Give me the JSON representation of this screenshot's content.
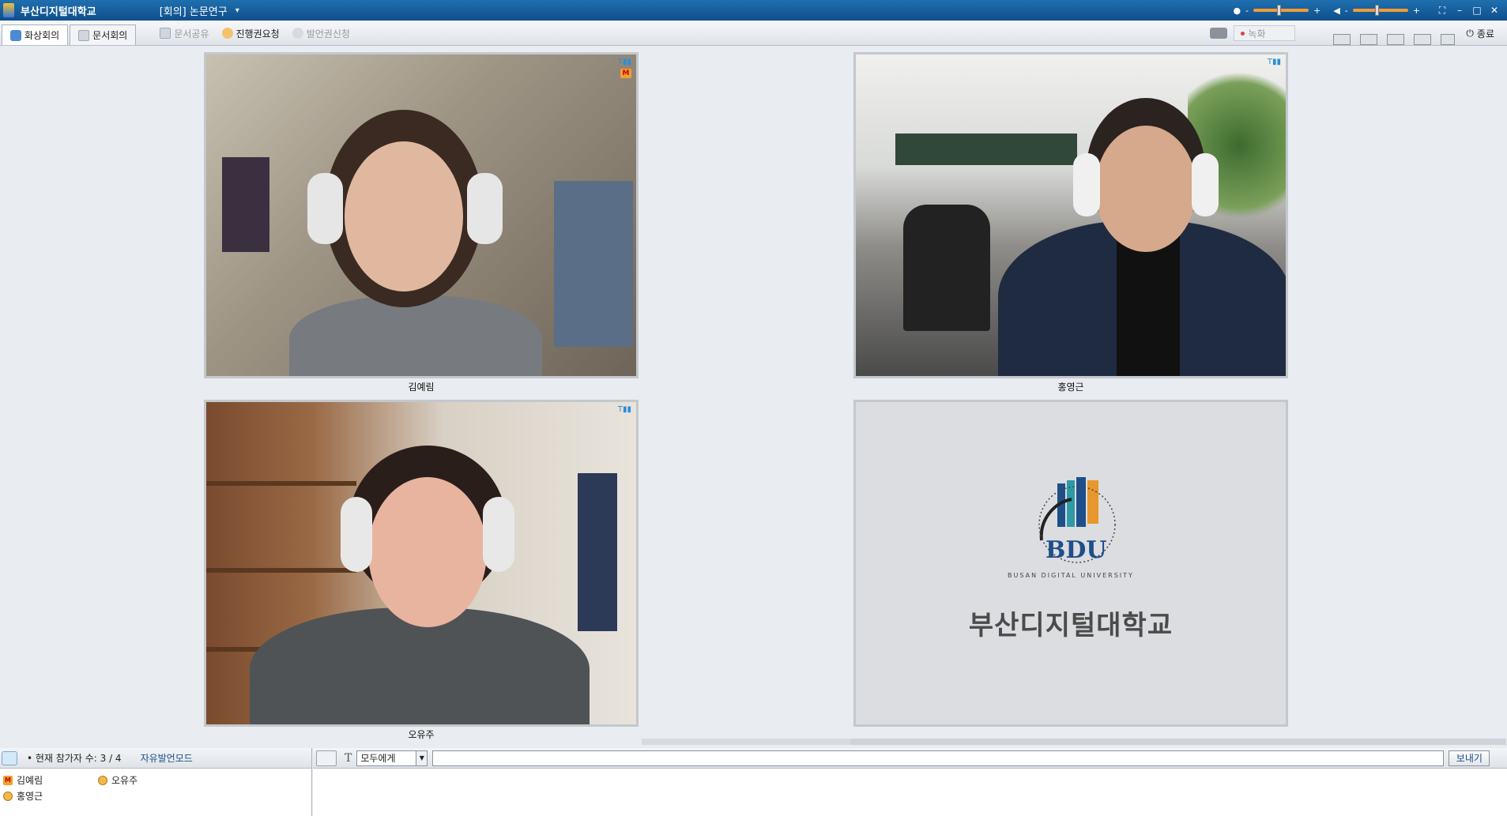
{
  "titlebar": {
    "app_title": "부산디지털대학교",
    "meeting_title": "[회의] 논문연구",
    "caret": "▾",
    "volume_icon": "speaker-icon",
    "mic_icon": "microphone-icon"
  },
  "toolbar": {
    "tabs": [
      {
        "label": "화상회의",
        "icon": "camera-icon"
      },
      {
        "label": "문서회의",
        "icon": "document-icon"
      }
    ],
    "tools": [
      {
        "label": "문서공유",
        "enabled": false,
        "icon": "document-share-icon"
      },
      {
        "label": "진행권요청",
        "enabled": true,
        "icon": "hand-icon"
      },
      {
        "label": "발언권신청",
        "enabled": false,
        "icon": "raise-hand-icon"
      }
    ],
    "record_label": "녹화",
    "exit_label": "종료"
  },
  "videos": [
    {
      "name": "김예림",
      "host": true,
      "host_badge": "M"
    },
    {
      "name": "홍영근",
      "host": false
    },
    {
      "name": "오유주",
      "host": false
    }
  ],
  "logo_tile": {
    "logo_text": "BDU",
    "ring_text": "BUSAN DIGITAL UNIVERSITY",
    "school_name": "부산디지털대학교",
    "colors": {
      "blue": "#1e4f8a",
      "orange": "#e8962e",
      "teal": "#2e9aa8"
    }
  },
  "participants_panel": {
    "count_label": "• 현재 참가자 수: 3 / 4",
    "mode_label": "자유발언모드",
    "list": [
      {
        "name": "김예림",
        "role": "host",
        "badge": "M"
      },
      {
        "name": "오유주",
        "role": "user"
      },
      {
        "name": "홍영근",
        "role": "user"
      }
    ]
  },
  "chat": {
    "font_icon": "T",
    "target_select": "모두에게",
    "input_value": "",
    "send_label": "보내기"
  },
  "colors": {
    "titlebar": "#1565a8",
    "accent_orange": "#f39c34",
    "background": "#e9ecf0"
  }
}
